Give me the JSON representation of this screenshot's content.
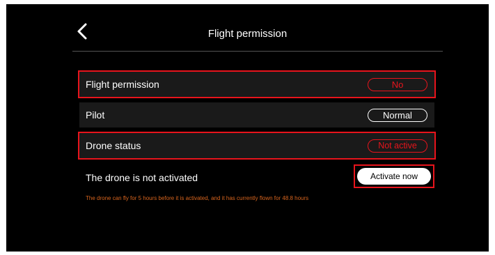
{
  "header": {
    "back_icon": "chevron-left-icon",
    "title": "Flight permission"
  },
  "rows": [
    {
      "label": "Flight permission",
      "value": "No"
    },
    {
      "label": "Pilot",
      "value": "Normal"
    },
    {
      "label": "Drone status",
      "value": "Not active"
    }
  ],
  "activation": {
    "message": "The drone is not activated",
    "button_label": "Activate now",
    "note": "The drone can fly for 5 hours before it is activated, and it has currently flown for 48.8 hours"
  },
  "colors": {
    "background": "#000000",
    "row_background": "#1a1a1a",
    "highlight": "#e8141c",
    "warning_text": "#d9651e",
    "text": "#ffffff"
  }
}
